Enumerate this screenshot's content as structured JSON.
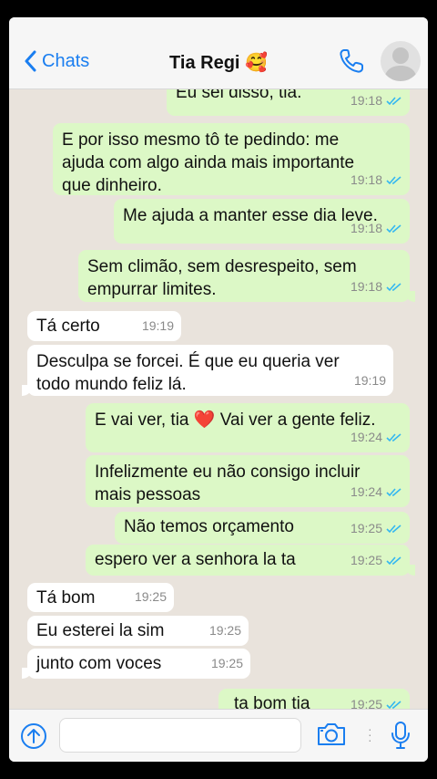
{
  "header": {
    "back_label": "Chats",
    "contact_name": "Tia Regi",
    "contact_emoji": "🥰"
  },
  "messages": [
    {
      "text": "Eu sei disso, tia.",
      "time": "19:18",
      "dir": "out"
    },
    {
      "text": "E por isso mesmo tô te pedindo: me ajuda com algo ainda mais importante que dinheiro.",
      "time": "19:18",
      "dir": "out"
    },
    {
      "text": "Me ajuda a manter esse dia leve.",
      "time": "19:18",
      "dir": "out"
    },
    {
      "text": "Sem climão, sem desrespeito, sem empurrar limites.",
      "time": "19:18",
      "dir": "out"
    },
    {
      "text": "Tá certo",
      "time": "19:19",
      "dir": "in"
    },
    {
      "text": "Desculpa se forcei. É que eu queria ver todo mundo feliz lá.",
      "time": "19:19",
      "dir": "in"
    },
    {
      "text_before": "E vai ver, tia",
      "emoji": "❤️",
      "text_after": "Vai ver a gente feliz.",
      "time": "19:24",
      "dir": "out"
    },
    {
      "text": "Infelizmente eu não consigo incluir mais pessoas",
      "time": "19:24",
      "dir": "out"
    },
    {
      "text": "Não temos orçamento",
      "time": "19:25",
      "dir": "out"
    },
    {
      "text": "espero ver a senhora la ta",
      "time": "19:25",
      "dir": "out"
    },
    {
      "text": "Tá bom",
      "time": "19:25",
      "dir": "in"
    },
    {
      "text": "Eu esterei la sim",
      "time": "19:25",
      "dir": "in"
    },
    {
      "text": "junto com voces",
      "time": "19:25",
      "dir": "in"
    },
    {
      "text": "ta bom tia",
      "time": "19:25",
      "dir": "out"
    }
  ],
  "colors": {
    "outgoing_bubble": "#dcf8c6",
    "incoming_bubble": "#ffffff",
    "chat_background": "#e9e3dc",
    "accent": "#1a7ef0",
    "read_ticks": "#34b7f1"
  }
}
